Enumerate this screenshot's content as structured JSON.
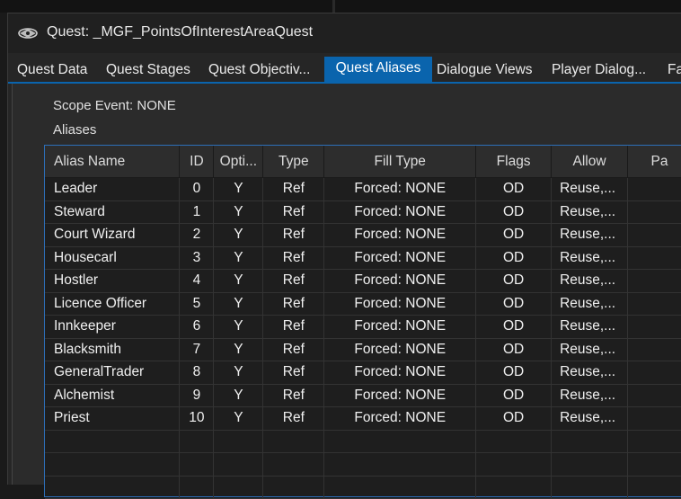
{
  "window": {
    "title": "Quest: _MGF_PointsOfInterestAreaQuest"
  },
  "tabs": [
    {
      "label": "Quest Data"
    },
    {
      "label": "Quest Stages"
    },
    {
      "label": "Quest Objectiv..."
    },
    {
      "label": "Quest Aliases",
      "active": true
    },
    {
      "label": "Dialogue Views"
    },
    {
      "label": "Player Dialog..."
    },
    {
      "label": "Fa"
    }
  ],
  "panel": {
    "scope_event": "Scope Event: NONE",
    "aliases_label": "Aliases"
  },
  "table": {
    "columns": [
      "Alias Name",
      "ID",
      "Opti...",
      "Type",
      "Fill Type",
      "Flags",
      "Allow",
      "Pa"
    ],
    "rows": [
      [
        "Leader",
        "0",
        "Y",
        "Ref",
        "Forced: NONE",
        "OD",
        "Reuse,..."
      ],
      [
        "Steward",
        "1",
        "Y",
        "Ref",
        "Forced: NONE",
        "OD",
        "Reuse,..."
      ],
      [
        "Court Wizard",
        "2",
        "Y",
        "Ref",
        "Forced: NONE",
        "OD",
        "Reuse,..."
      ],
      [
        "Housecarl",
        "3",
        "Y",
        "Ref",
        "Forced: NONE",
        "OD",
        "Reuse,..."
      ],
      [
        "Hostler",
        "4",
        "Y",
        "Ref",
        "Forced: NONE",
        "OD",
        "Reuse,..."
      ],
      [
        "Licence Officer",
        "5",
        "Y",
        "Ref",
        "Forced: NONE",
        "OD",
        "Reuse,..."
      ],
      [
        "Innkeeper",
        "6",
        "Y",
        "Ref",
        "Forced: NONE",
        "OD",
        "Reuse,..."
      ],
      [
        "Blacksmith",
        "7",
        "Y",
        "Ref",
        "Forced: NONE",
        "OD",
        "Reuse,..."
      ],
      [
        "GeneralTrader",
        "8",
        "Y",
        "Ref",
        "Forced: NONE",
        "OD",
        "Reuse,..."
      ],
      [
        "Alchemist",
        "9",
        "Y",
        "Ref",
        "Forced: NONE",
        "OD",
        "Reuse,..."
      ],
      [
        "Priest",
        "10",
        "Y",
        "Ref",
        "Forced: NONE",
        "OD",
        "Reuse,..."
      ]
    ]
  },
  "colors": {
    "accent": "#0a64ad",
    "grid_border": "#2d6fb8",
    "background": "#262626"
  },
  "icons": {
    "app": "creation-kit-logo-icon"
  }
}
